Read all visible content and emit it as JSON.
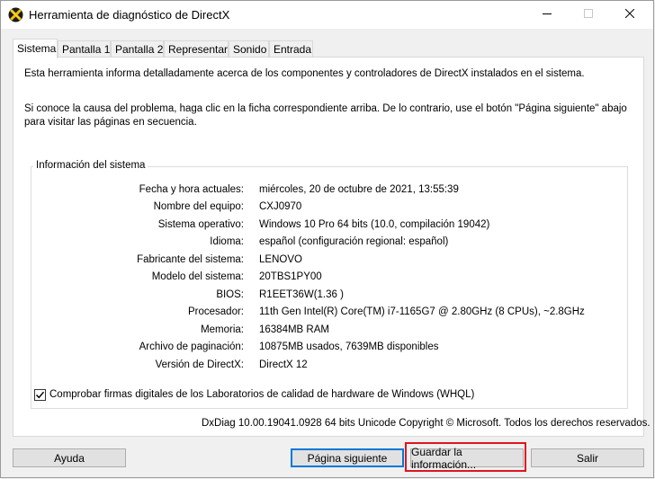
{
  "window": {
    "title": "Herramienta de diagnóstico de DirectX"
  },
  "tabs": [
    {
      "label": "Sistema",
      "active": true
    },
    {
      "label": "Pantalla 1"
    },
    {
      "label": "Pantalla 2"
    },
    {
      "label": "Representar"
    },
    {
      "label": "Sonido"
    },
    {
      "label": "Entrada"
    }
  ],
  "intro": {
    "line1": "Esta herramienta informa detalladamente acerca de los componentes y controladores de DirectX instalados en el sistema.",
    "line2": "Si conoce la causa del problema, haga clic en la ficha correspondiente arriba. De lo contrario, use el botón \"Página siguiente\" abajo para visitar las páginas en secuencia."
  },
  "system_info": {
    "group_label": "Información del sistema",
    "rows": [
      {
        "label": "Fecha y hora actuales:",
        "value": "miércoles, 20 de octubre de 2021, 13:55:39"
      },
      {
        "label": "Nombre del equipo:",
        "value": "CXJ0970"
      },
      {
        "label": "Sistema operativo:",
        "value": "Windows 10 Pro 64 bits (10.0, compilación 19042)"
      },
      {
        "label": "Idioma:",
        "value": "español (configuración regional: español)"
      },
      {
        "label": "Fabricante del sistema:",
        "value": "LENOVO"
      },
      {
        "label": "Modelo del sistema:",
        "value": "20TBS1PY00"
      },
      {
        "label": "BIOS:",
        "value": "R1EET36W(1.36 )"
      },
      {
        "label": "Procesador:",
        "value": "11th Gen Intel(R) Core(TM) i7-1165G7 @ 2.80GHz (8 CPUs), ~2.8GHz"
      },
      {
        "label": "Memoria:",
        "value": "16384MB RAM"
      },
      {
        "label": "Archivo de paginación:",
        "value": "10875MB usados, 7639MB disponibles"
      },
      {
        "label": "Versión de DirectX:",
        "value": "DirectX 12"
      }
    ]
  },
  "whql_checkbox": {
    "label": "Comprobar firmas digitales de los Laboratorios de calidad de hardware de Windows (WHQL)",
    "checked": true
  },
  "copyright": "DxDiag 10.00.19041.0928 64 bits Unicode  Copyright © Microsoft. Todos los derechos reservados.",
  "buttons": {
    "help": "Ayuda",
    "next": "Página siguiente",
    "save": "Guardar la información...",
    "exit": "Salir"
  },
  "colors": {
    "highlight": "#e0141e",
    "default_button_border": "#0078d7"
  },
  "icons": {
    "app": "directx-icon",
    "minimize": "minimize-icon",
    "maximize": "maximize-icon",
    "close": "close-icon",
    "check": "checkmark-icon"
  }
}
